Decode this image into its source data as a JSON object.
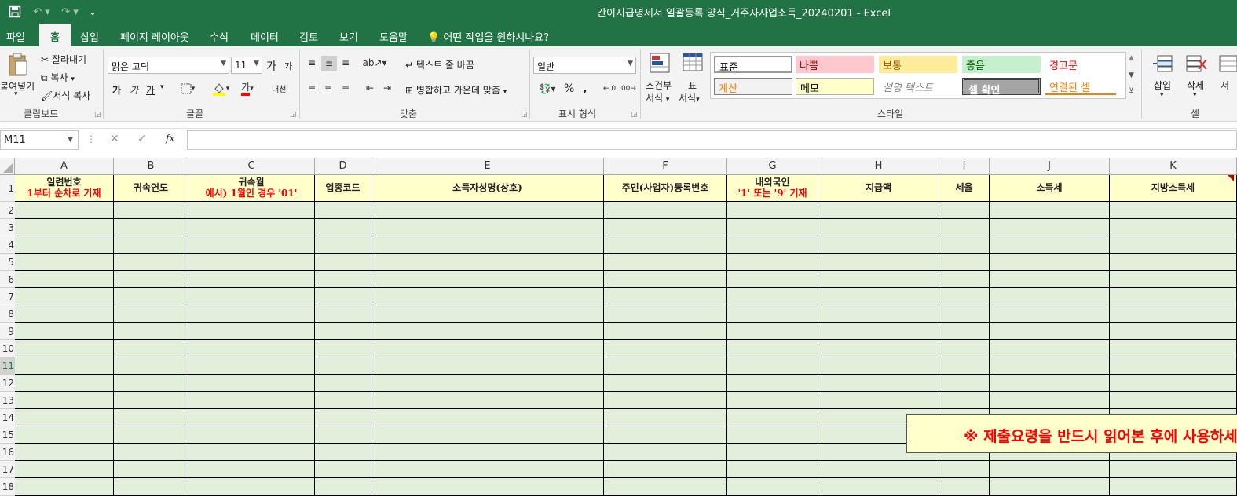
{
  "window": {
    "title": "간이지급명세서 일괄등록 양식_거주자사업소득_20240201  -  Excel"
  },
  "qat": {
    "save_icon": "save-icon",
    "undo_icon": "undo-icon",
    "redo_icon": "redo-icon",
    "customize": "⌄"
  },
  "tabs": [
    "파일",
    "홈",
    "삽입",
    "페이지 레이아웃",
    "수식",
    "데이터",
    "검토",
    "보기",
    "도움말"
  ],
  "tell_me": "어떤 작업을 원하시나요?",
  "clipboard": {
    "paste": "붙여넣기",
    "cut": "잘라내기",
    "copy": "복사",
    "format_painter": "서식 복사",
    "group": "클립보드"
  },
  "font": {
    "name": "맑은 고딕",
    "size": "11",
    "group": "글꼴",
    "grow": "가",
    "shrink": "가",
    "bold": "가",
    "italic": "가",
    "underline": "가",
    "font_color": "가",
    "phonetic": "내천"
  },
  "alignment": {
    "wrap": "텍스트 줄 바꿈",
    "merge": "병합하고 가운데 맞춤",
    "group": "맞춤"
  },
  "number": {
    "format": "일반",
    "group": "표시 형식",
    "percent": "%",
    "comma": ","
  },
  "styles": {
    "conditional": "조건부",
    "conditional2": "서식",
    "table": "표",
    "table2": "서식",
    "group": "스타일",
    "items": [
      {
        "label": "표준",
        "bg": "#ffffff",
        "color": "#000000"
      },
      {
        "label": "나쁨",
        "bg": "#ffc7ce",
        "color": "#9c0006"
      },
      {
        "label": "보통",
        "bg": "#ffeb9c",
        "color": "#9c5700"
      },
      {
        "label": "좋음",
        "bg": "#c6efce",
        "color": "#006100"
      },
      {
        "label": "경고문",
        "bg": "#ffffff",
        "color": "#ff0000"
      },
      {
        "label": "계산",
        "bg": "#f2f2f2",
        "color": "#fa7d00"
      },
      {
        "label": "메모",
        "bg": "#ffffcc",
        "color": "#000000"
      },
      {
        "label": "설명 텍스트",
        "bg": "#ffffff",
        "color": "#7f7f7f"
      },
      {
        "label": "셀 확인",
        "bg": "#a5a5a5",
        "color": "#ffffff"
      },
      {
        "label": "연결된 셀",
        "bg": "#ffffff",
        "color": "#fa7d00"
      }
    ]
  },
  "cells": {
    "insert": "삽입",
    "delete": "삭제",
    "format": "서",
    "group": "셀"
  },
  "formula_bar": {
    "name_box": "M11",
    "fx": "fx",
    "cancel": "✕",
    "enter": "✓",
    "value": ""
  },
  "columns": [
    {
      "letter": "A",
      "h1": "일련번호",
      "h2": "1부터 순차로 기재"
    },
    {
      "letter": "B",
      "h1": "귀속연도",
      "h2": ""
    },
    {
      "letter": "C",
      "h1": "귀속월",
      "h2": "예시) 1월인 경우  '01'"
    },
    {
      "letter": "D",
      "h1": "업종코드",
      "h2": ""
    },
    {
      "letter": "E",
      "h1": "소득자성명(상호)",
      "h2": ""
    },
    {
      "letter": "F",
      "h1": "주민(사업자)등록번호",
      "h2": ""
    },
    {
      "letter": "G",
      "h1": "내외국인",
      "h2": "'1' 또는 '9' 기재"
    },
    {
      "letter": "H",
      "h1": "지급액",
      "h2": ""
    },
    {
      "letter": "I",
      "h1": "세율",
      "h2": ""
    },
    {
      "letter": "J",
      "h1": "소득세",
      "h2": ""
    },
    {
      "letter": "K",
      "h1": "지방소득세",
      "h2": ""
    }
  ],
  "rows": [
    "1",
    "2",
    "3",
    "4",
    "5",
    "6",
    "7",
    "8",
    "9",
    "10",
    "11",
    "12",
    "13",
    "14",
    "15",
    "16",
    "17",
    "18"
  ],
  "notice": "※ 제출요령을 반드시 읽어본 후에 사용하세요"
}
